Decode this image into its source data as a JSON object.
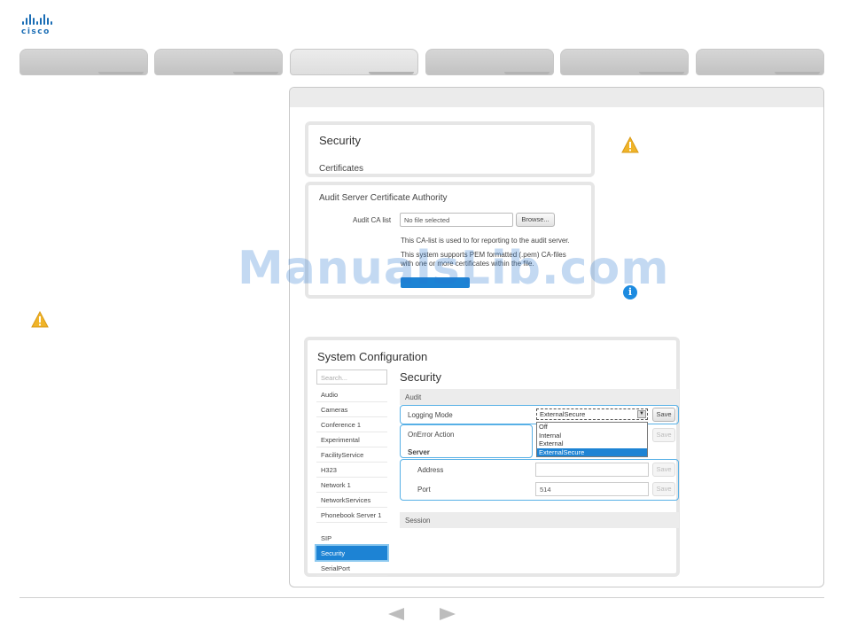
{
  "brand": {
    "name": "cisco",
    "color": "#1a6db5"
  },
  "tabs": [
    {
      "active": false
    },
    {
      "active": false
    },
    {
      "active": true
    },
    {
      "active": false
    },
    {
      "active": false
    },
    {
      "active": false
    }
  ],
  "security_section": {
    "title": "Security",
    "subtitle": "Certificates",
    "ca_title": "Audit Server Certificate Authority",
    "ca_list_label": "Audit CA list",
    "file_value": "No file selected",
    "browse_label": "Browse...",
    "info_line1": "This CA-list is used to for reporting to the audit server.",
    "info_line2": "This system supports PEM formatted (.pem) CA-files",
    "info_line3": "with one or more certificates within the file."
  },
  "watermark": "ManualsLib.com",
  "system_config": {
    "title": "System Configuration",
    "search_placeholder": "Search...",
    "menu": [
      "Audio",
      "Cameras",
      "Conference 1",
      "Experimental",
      "FacilityService",
      "H323",
      "Network 1",
      "NetworkServices",
      "Phonebook Server 1",
      "SIP",
      "Security",
      "SerialPort"
    ],
    "active_menu": "Security",
    "page_title": "Security",
    "audit_header": "Audit",
    "logging_mode_label": "Logging Mode",
    "logging_mode_value": "ExternalSecure",
    "logging_options": [
      "Off",
      "Internal",
      "External",
      "ExternalSecure"
    ],
    "onerror_label": "OnError Action",
    "server_label": "Server",
    "address_label": "Address",
    "port_label": "Port",
    "port_value": "514",
    "save_label": "Save",
    "session_header": "Session"
  },
  "colors": {
    "accent": "#1d83d4",
    "highlight": "#57b0e6",
    "warning": "#f0b429",
    "info": "#1d8be0"
  }
}
